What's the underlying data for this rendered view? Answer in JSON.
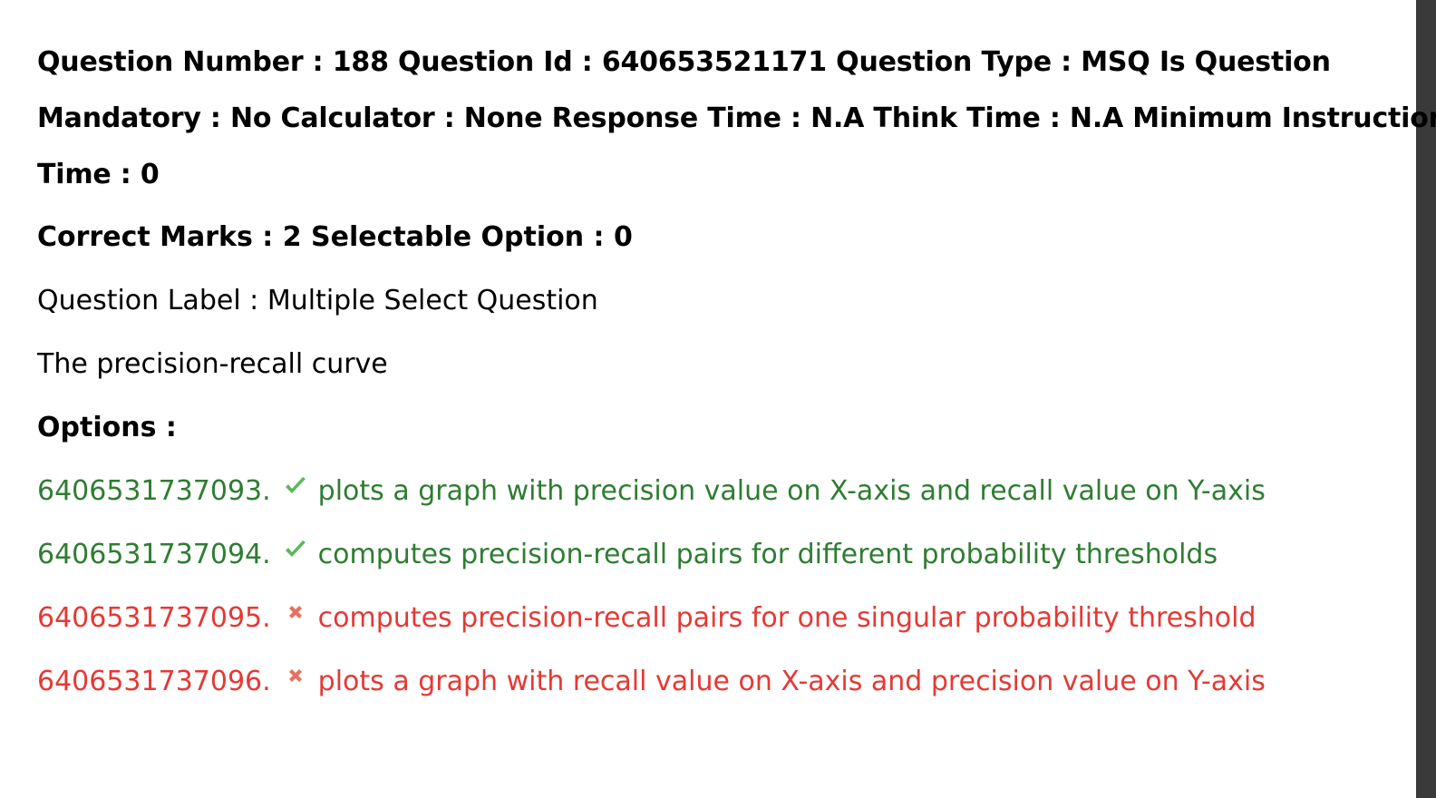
{
  "question": {
    "meta_line_1": "Question Number : 188 Question Id : 640653521171 Question Type : MSQ Is Question",
    "meta_line_2": "Mandatory : No Calculator : None Response Time : N.A Think Time : N.A Minimum Instruction",
    "meta_line_3": "Time : 0",
    "marks_line": "Correct Marks : 2 Selectable Option : 0",
    "label_line": "Question Label : Multiple Select Question",
    "text": "The precision-recall curve",
    "options_heading": "Options :"
  },
  "options": [
    {
      "id": "6406531737093.",
      "text": "plots a graph with precision value on X-axis and recall value on Y-axis",
      "status": "correct",
      "icon": "check-icon"
    },
    {
      "id": "6406531737094.",
      "text": "computes precision-recall pairs for different probability thresholds",
      "status": "correct",
      "icon": "check-icon"
    },
    {
      "id": "6406531737095.",
      "text": "computes precision-recall pairs for one singular probability threshold",
      "status": "wrong",
      "icon": "cross-icon"
    },
    {
      "id": "6406531737096.",
      "text": "plots a graph with recall value on X-axis and precision value on Y-axis",
      "status": "wrong",
      "icon": "cross-icon"
    }
  ],
  "colors": {
    "correct": "#2e7d32",
    "wrong": "#e53935",
    "check_icon": "#5cb85c",
    "cross_icon": "#e8705f"
  }
}
